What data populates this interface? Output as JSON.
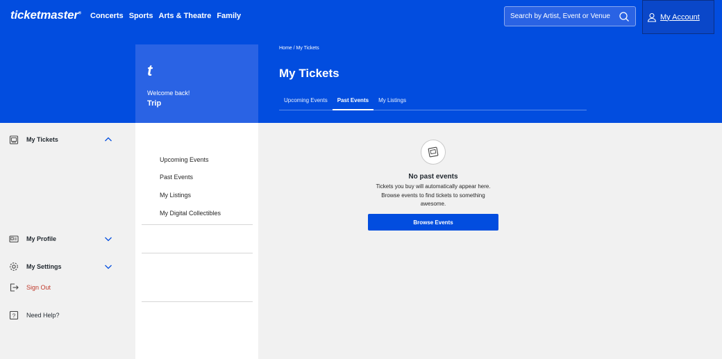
{
  "header": {
    "logo_text": "ticketmaster",
    "logo_mark": "®",
    "nav": [
      "Concerts",
      "Sports",
      "Arts & Theatre",
      "Family"
    ],
    "search_placeholder": "Search by Artist, Event or Venue",
    "account_label": "My Account"
  },
  "profile": {
    "initial": "t",
    "welcome": "Welcome back!",
    "name": "Trip"
  },
  "sidebar": {
    "my_tickets": {
      "label": "My Tickets",
      "items": [
        "Upcoming Events",
        "Past Events",
        "My Listings",
        "My Digital Collectibles"
      ]
    },
    "my_profile": "My Profile",
    "my_settings": "My Settings",
    "sign_out": "Sign Out",
    "help": "Need Help?"
  },
  "main": {
    "breadcrumb": {
      "home": "Home",
      "separator": " / ",
      "current": "My Tickets"
    },
    "title": "My Tickets",
    "tabs": [
      "Upcoming Events",
      "Past Events",
      "My Listings"
    ],
    "active_tab": "Past Events",
    "empty_title": "No past events",
    "empty_desc": "Tickets you buy will automatically appear here. Browse events to find tickets to something awesome.",
    "cta": "Browse Events"
  },
  "colors": {
    "brand_blue": "#024ddf",
    "sign_out_red": "#c0392b"
  },
  "icons": [
    "search-icon",
    "user-icon",
    "ticket-icon",
    "chevron-up-icon",
    "chevron-down-icon",
    "id-card-icon",
    "gear-icon",
    "sign-out-icon",
    "help-icon"
  ]
}
